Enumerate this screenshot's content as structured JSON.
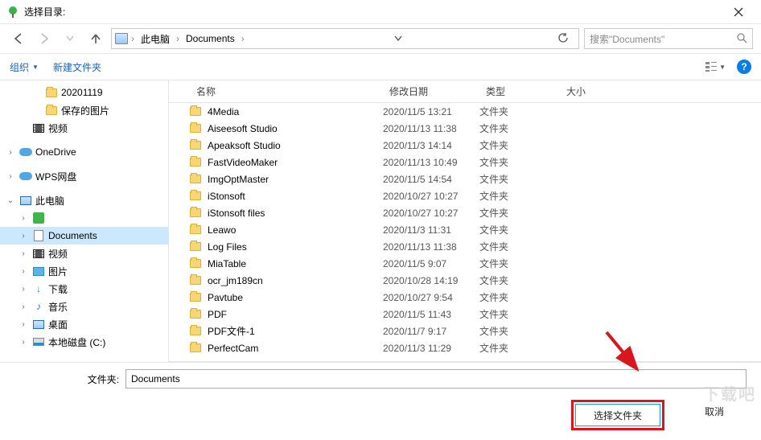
{
  "title": "选择目录:",
  "nav": {
    "path_pc": "此电脑",
    "path_folder": "Documents",
    "search_placeholder": "搜索\"Documents\""
  },
  "toolbar": {
    "organize": "组织",
    "new_folder": "新建文件夹"
  },
  "tree": [
    {
      "label": "20201119",
      "indent": 2,
      "icon": "folder",
      "arrow": ""
    },
    {
      "label": "保存的图片",
      "indent": 2,
      "icon": "folder",
      "arrow": ""
    },
    {
      "label": "视频",
      "indent": 1,
      "icon": "video",
      "arrow": ""
    },
    {
      "spacer": true
    },
    {
      "label": "OneDrive",
      "indent": 0,
      "icon": "cloud",
      "arrow": ">"
    },
    {
      "spacer": true
    },
    {
      "label": "WPS网盘",
      "indent": 0,
      "icon": "cloud",
      "arrow": ">"
    },
    {
      "spacer": true
    },
    {
      "label": "此电脑",
      "indent": 0,
      "icon": "monitor",
      "arrow": "v"
    },
    {
      "label": "",
      "indent": 1,
      "icon": "green",
      "arrow": ">"
    },
    {
      "label": "Documents",
      "indent": 1,
      "icon": "doc",
      "arrow": ">",
      "selected": true
    },
    {
      "label": "视频",
      "indent": 1,
      "icon": "video",
      "arrow": ">"
    },
    {
      "label": "图片",
      "indent": 1,
      "icon": "pic",
      "arrow": ">"
    },
    {
      "label": "下载",
      "indent": 1,
      "icon": "download",
      "arrow": ">"
    },
    {
      "label": "音乐",
      "indent": 1,
      "icon": "music",
      "arrow": ">"
    },
    {
      "label": "桌面",
      "indent": 1,
      "icon": "monitor",
      "arrow": ">"
    },
    {
      "label": "本地磁盘 (C:)",
      "indent": 1,
      "icon": "disk",
      "arrow": ">"
    }
  ],
  "columns": {
    "name": "名称",
    "date": "修改日期",
    "type": "类型",
    "size": "大小"
  },
  "files": [
    {
      "name": "4Media",
      "date": "2020/11/5 13:21",
      "type": "文件夹"
    },
    {
      "name": "Aiseesoft Studio",
      "date": "2020/11/13 11:38",
      "type": "文件夹"
    },
    {
      "name": "Apeaksoft Studio",
      "date": "2020/11/3 14:14",
      "type": "文件夹"
    },
    {
      "name": "FastVideoMaker",
      "date": "2020/11/13 10:49",
      "type": "文件夹"
    },
    {
      "name": "ImgOptMaster",
      "date": "2020/11/5 14:54",
      "type": "文件夹"
    },
    {
      "name": "iStonsoft",
      "date": "2020/10/27 10:27",
      "type": "文件夹"
    },
    {
      "name": "iStonsoft files",
      "date": "2020/10/27 10:27",
      "type": "文件夹"
    },
    {
      "name": "Leawo",
      "date": "2020/11/3 11:31",
      "type": "文件夹"
    },
    {
      "name": "Log Files",
      "date": "2020/11/13 11:38",
      "type": "文件夹"
    },
    {
      "name": "MiaTable",
      "date": "2020/11/5 9:07",
      "type": "文件夹"
    },
    {
      "name": "ocr_jm189cn",
      "date": "2020/10/28 14:19",
      "type": "文件夹"
    },
    {
      "name": "Pavtube",
      "date": "2020/10/27 9:54",
      "type": "文件夹"
    },
    {
      "name": "PDF",
      "date": "2020/11/5 11:43",
      "type": "文件夹"
    },
    {
      "name": "PDF文件-1",
      "date": "2020/11/7 9:17",
      "type": "文件夹"
    },
    {
      "name": "PerfectCam",
      "date": "2020/11/3 11:29",
      "type": "文件夹"
    }
  ],
  "footer": {
    "folder_label": "文件夹:",
    "folder_value": "Documents",
    "select_btn": "选择文件夹",
    "cancel_btn": "取消"
  }
}
